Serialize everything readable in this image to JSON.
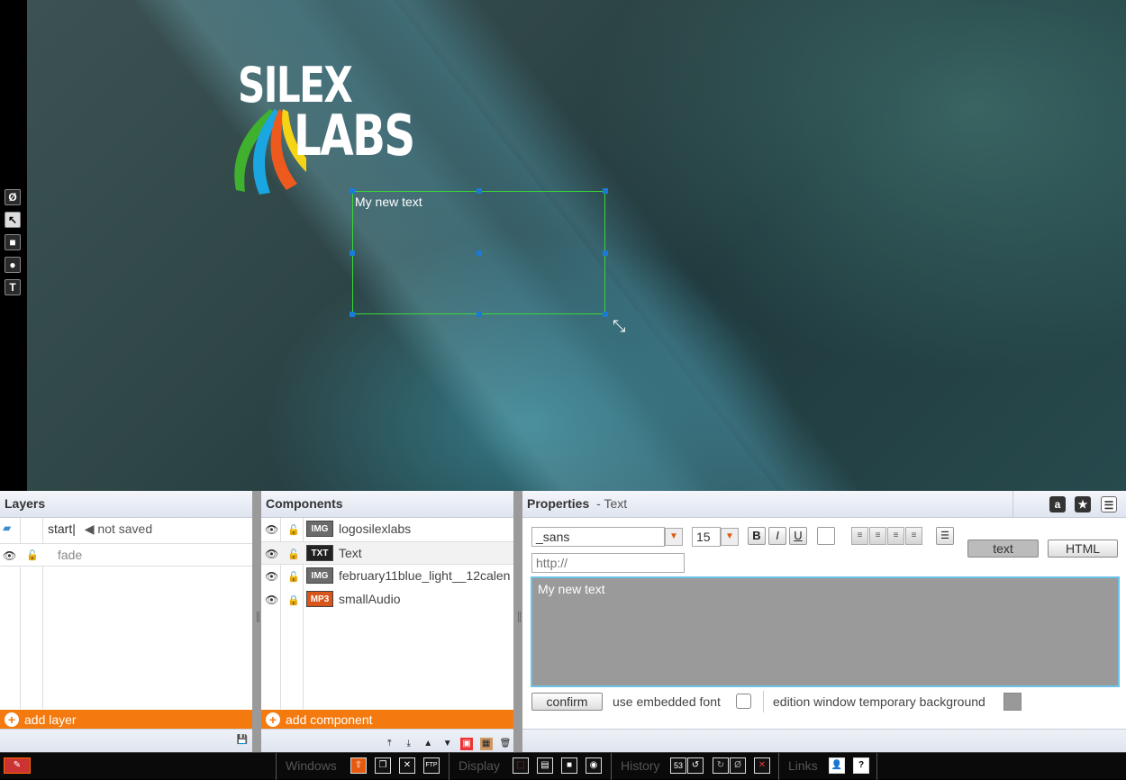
{
  "stage": {
    "logo": {
      "line1": "SILEX",
      "line2": "LABS"
    },
    "text_element": "My new text",
    "tools": [
      "no-select-icon",
      "pointer-icon",
      "rectangle-icon",
      "circle-icon",
      "text-tool-icon"
    ]
  },
  "layers": {
    "title": "Layers",
    "items": [
      {
        "name": "start|",
        "status": "◀ not saved"
      },
      {
        "name": "fade"
      }
    ],
    "add_label": "add layer"
  },
  "components": {
    "title": "Components",
    "items": [
      {
        "type": "IMG",
        "name": "logosilexlabs",
        "locked": false
      },
      {
        "type": "TXT",
        "name": "Text",
        "locked": false
      },
      {
        "type": "IMG",
        "name": "february11blue_light__12calen",
        "locked": false
      },
      {
        "type": "MP3",
        "name": "smallAudio",
        "locked": true
      }
    ],
    "add_label": "add component"
  },
  "properties": {
    "title": "Properties",
    "subtitle": "- Text",
    "font": "_sans",
    "size": "15",
    "link_placeholder": "http://",
    "mode_text": "text",
    "mode_html": "HTML",
    "editor_text": "My new text",
    "confirm": "confirm",
    "embedded_font": "use embedded font",
    "temp_background": "edition window temporary background"
  },
  "taskbar": {
    "windows": "Windows",
    "display": "Display",
    "history": "History",
    "history_count": "53",
    "links": "Links"
  },
  "colors": {
    "accent": "#f47a10",
    "selection": "#38d838",
    "handle": "#1a7ad6",
    "editor_border": "#6cc3e8"
  }
}
